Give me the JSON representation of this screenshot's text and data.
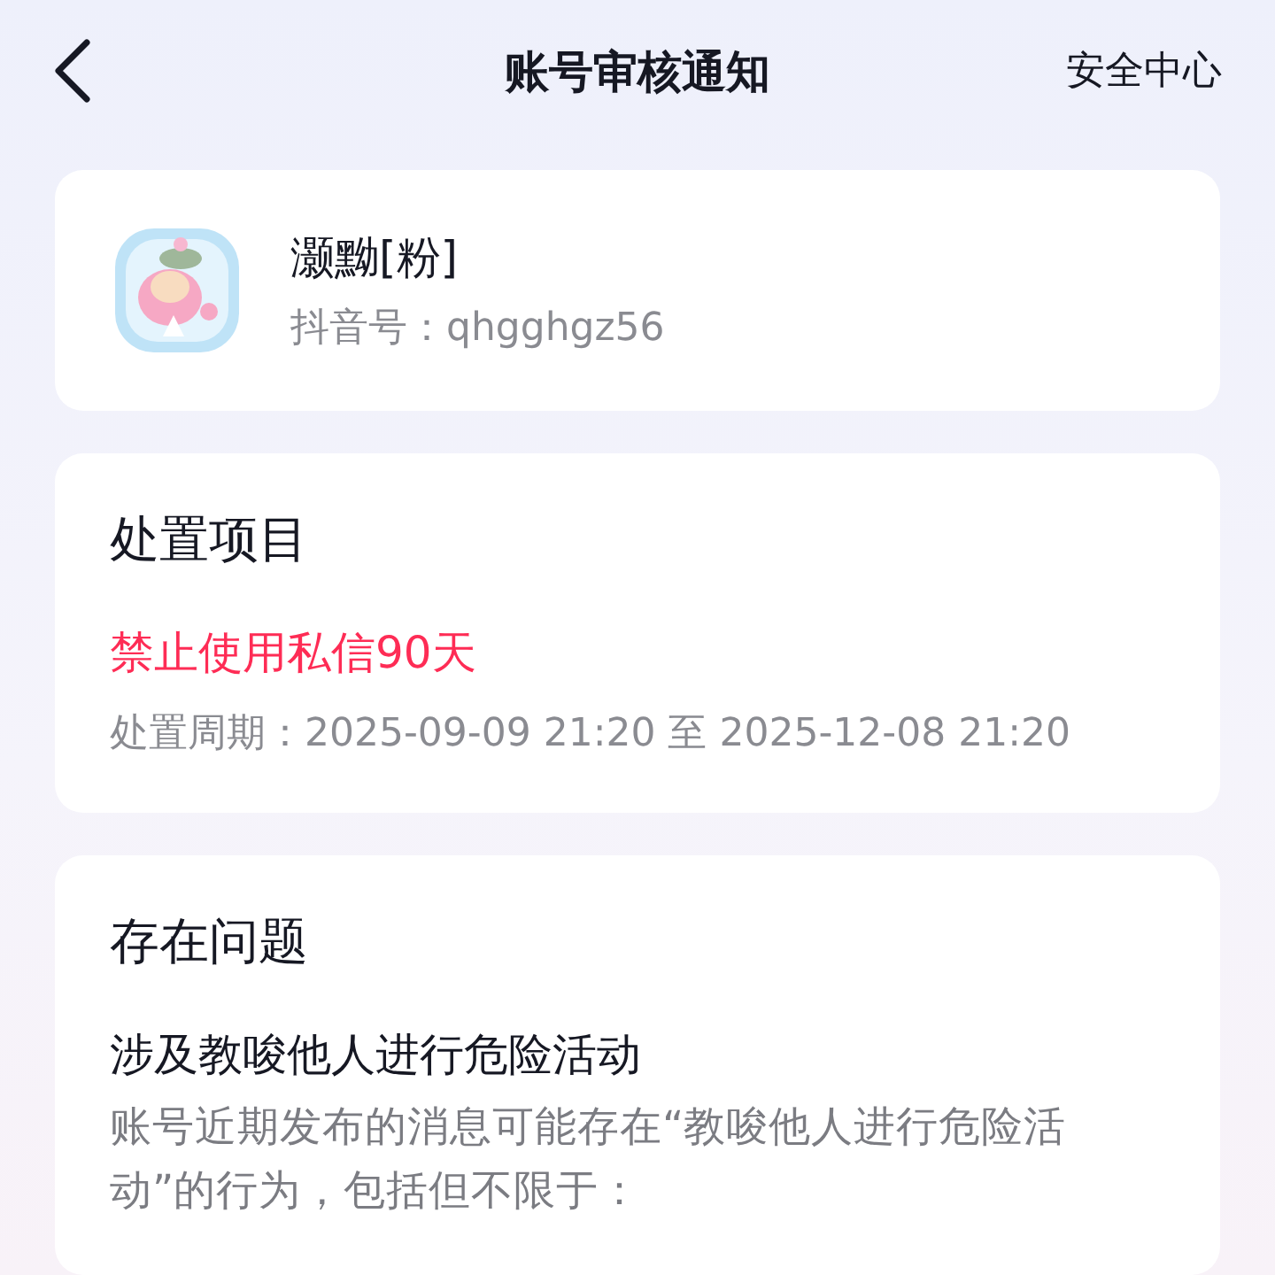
{
  "header": {
    "title": "账号审核通知",
    "action": "安全中心"
  },
  "profile": {
    "name": "灏黝[粉]",
    "id_label": "抖音号：",
    "id_value": "qhgghgz56"
  },
  "penalty": {
    "heading": "处置项目",
    "item": "禁止使用私信90天",
    "period_label": "处置周期：",
    "period": "2025-09-09 21:20 至 2025-12-08 21:20"
  },
  "issue": {
    "heading": "存在问题",
    "title": "涉及教唆他人进行危险活动",
    "description": "账号近期发布的消息可能存在“教唆他人进行危险活动”的行为，包括但不限于："
  }
}
